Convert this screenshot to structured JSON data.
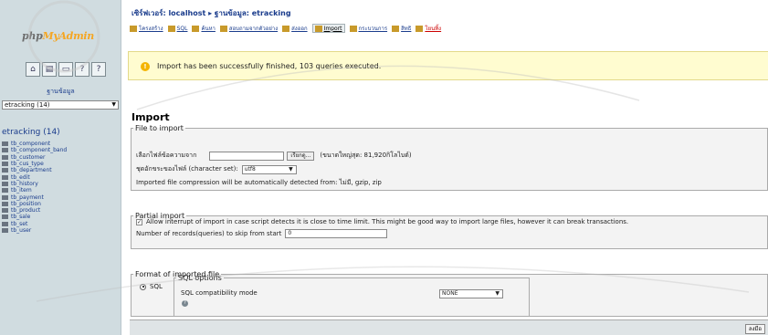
{
  "sidebar": {
    "logo_part1": "php",
    "logo_part2": "MyAdmin",
    "icons": [
      "home-icon",
      "sql-icon",
      "query-window-icon",
      "docs-icon",
      "docs2-icon"
    ],
    "db_label": "ฐานข้อมูล",
    "db_select_value": "etracking (14)",
    "db_title": "etracking (14)",
    "tables": [
      "tb_component",
      "tb_component_band",
      "tb_customer",
      "tb_cus_type",
      "tb_department",
      "tb_edit",
      "tb_history",
      "tb_item",
      "tb_payment",
      "tb_position",
      "tb_product",
      "tb_sale",
      "tb_set",
      "tb_user"
    ]
  },
  "header": {
    "breadcrumb": "เซิร์ฟเวอร์: localhost ▸ ฐานข้อมูล: etracking",
    "tabs": [
      {
        "label": "โครงสร้าง"
      },
      {
        "label": "SQL"
      },
      {
        "label": "ค้นหา"
      },
      {
        "label": "สอบถามจากตัวอย่าง"
      },
      {
        "label": "ส่งออก"
      },
      {
        "label": "Import"
      },
      {
        "label": "กระบวนการ"
      },
      {
        "label": "สิทธิ"
      },
      {
        "label": "โยนทิ้ง"
      }
    ]
  },
  "notice": {
    "text": "Import has been successfully finished, 103 queries executed."
  },
  "main": {
    "heading": "Import",
    "file_to_import": {
      "legend": "File to import",
      "location_label": "เลือกไฟล์ข้อความจาก",
      "browse_label": "เรียกดู...",
      "max_size": "(ขนาดใหญ่สุด: 81,920กิโลไบต์)",
      "charset_label": "ชุดอักขระของไฟล์ (character set):",
      "charset_value": "utf8",
      "compression_note": "Imported file compression will be automatically detected from: ไม่มี, gzip, zip"
    },
    "partial_import": {
      "legend": "Partial import",
      "allow_interrupt_label": "Allow interrupt of import in case script detects it is close to time limit. This might be good way to import large files, however it can break transactions.",
      "skip_label": "Number of records(queries) to skip from start",
      "skip_value": "0"
    },
    "format": {
      "legend": "Format of imported file",
      "sql_label": "SQL",
      "sql_options_legend": "SQL options",
      "compat_label": "SQL compatibility mode",
      "compat_value": "NONE"
    },
    "go_button": "ลงมือ"
  }
}
